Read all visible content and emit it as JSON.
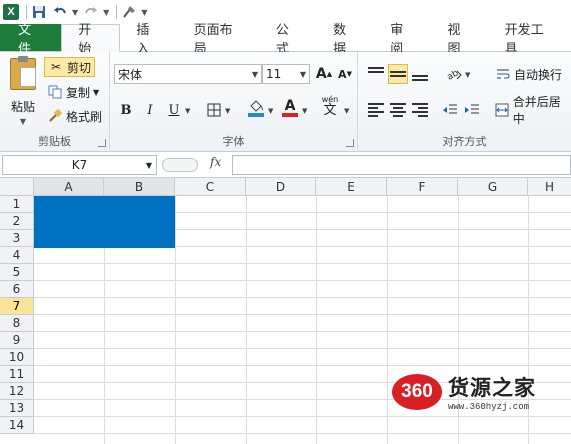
{
  "quick_access": {
    "icons": [
      "excel-logo",
      "save-icon",
      "undo-icon",
      "redo-icon",
      "brush-icon"
    ],
    "logo_letter": "X"
  },
  "tabs": [
    "文件",
    "开始",
    "插入",
    "页面布局",
    "公式",
    "数据",
    "审阅",
    "视图",
    "开发工具"
  ],
  "active_tab": "开始",
  "ribbon": {
    "clipboard": {
      "label": "剪贴板",
      "paste": "粘贴",
      "cut": "剪切",
      "copy": "复制",
      "format_painter": "格式刷"
    },
    "font": {
      "label": "字体",
      "font_name": "宋体",
      "font_size": "11",
      "bold": "B",
      "italic": "I",
      "underline": "U",
      "font_color_letter": "A",
      "wen_label": "wén"
    },
    "alignment": {
      "label": "对齐方式",
      "wrap_text": "自动换行",
      "merge_center": "合并后居中"
    }
  },
  "formula_bar": {
    "name_box": "K7",
    "fx": "fx",
    "content": ""
  },
  "grid": {
    "columns": [
      "A",
      "B",
      "C",
      "D",
      "E",
      "F",
      "G",
      "H"
    ],
    "rows": [
      "1",
      "2",
      "3",
      "4",
      "5",
      "6",
      "7",
      "8",
      "9",
      "10",
      "11",
      "12",
      "13",
      "14"
    ],
    "selection_range": "A1:B3",
    "selection_color": "#0070c0",
    "active_row": "7"
  },
  "watermark": {
    "badge": "360",
    "name": "货源之家",
    "url": "www.360hyzj.com"
  },
  "colors": {
    "file_tab": "#1f7d3c",
    "selection": "#0070c0",
    "watermark_red": "#d91f26"
  }
}
